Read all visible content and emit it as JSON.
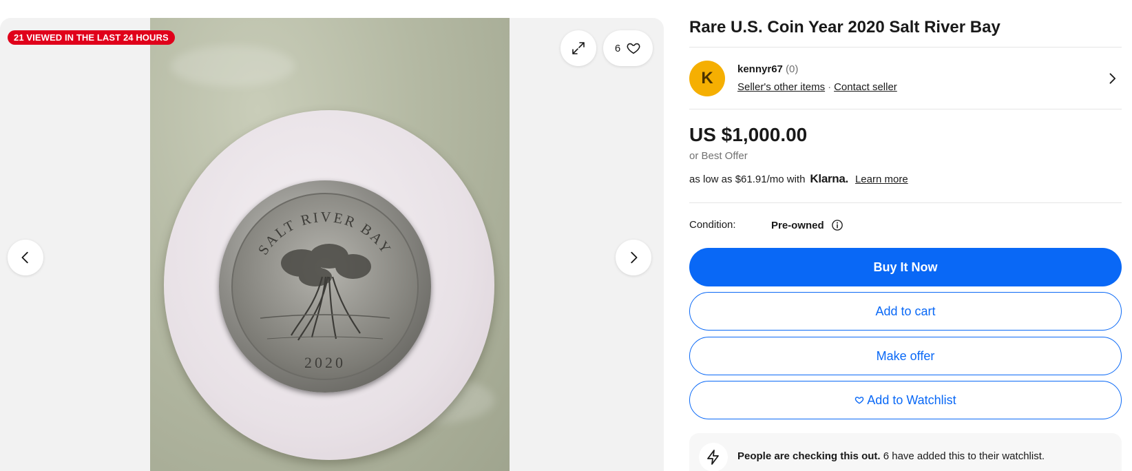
{
  "gallery": {
    "badge": "21 VIEWED IN THE LAST 24 HOURS",
    "watch_count": "6",
    "coin_top_legend": "SALT RIVER BAY",
    "coin_year": "2020"
  },
  "listing": {
    "title": "Rare U.S. Coin Year 2020 Salt River Bay",
    "seller": {
      "initial": "K",
      "name": "kennyr67",
      "score": "(0)",
      "other_items": "Seller's other items",
      "separator": "·",
      "contact": "Contact seller"
    },
    "price": "US $1,000.00",
    "best_offer": "or Best Offer",
    "financing": {
      "prefix": "as low as $61.91/mo with",
      "brand": "Klarna.",
      "learn_more": "Learn more"
    },
    "condition": {
      "label": "Condition:",
      "value": "Pre-owned"
    },
    "actions": {
      "buy_now": "Buy It Now",
      "add_to_cart": "Add to cart",
      "make_offer": "Make offer",
      "add_to_watchlist": "Add to Watchlist"
    },
    "alert": {
      "bold": "People are checking this out.",
      "text": " 6 have added this to their watchlist."
    }
  },
  "colors": {
    "accent": "#0968f6",
    "badge": "#e0001b",
    "avatar": "#f5af02"
  }
}
